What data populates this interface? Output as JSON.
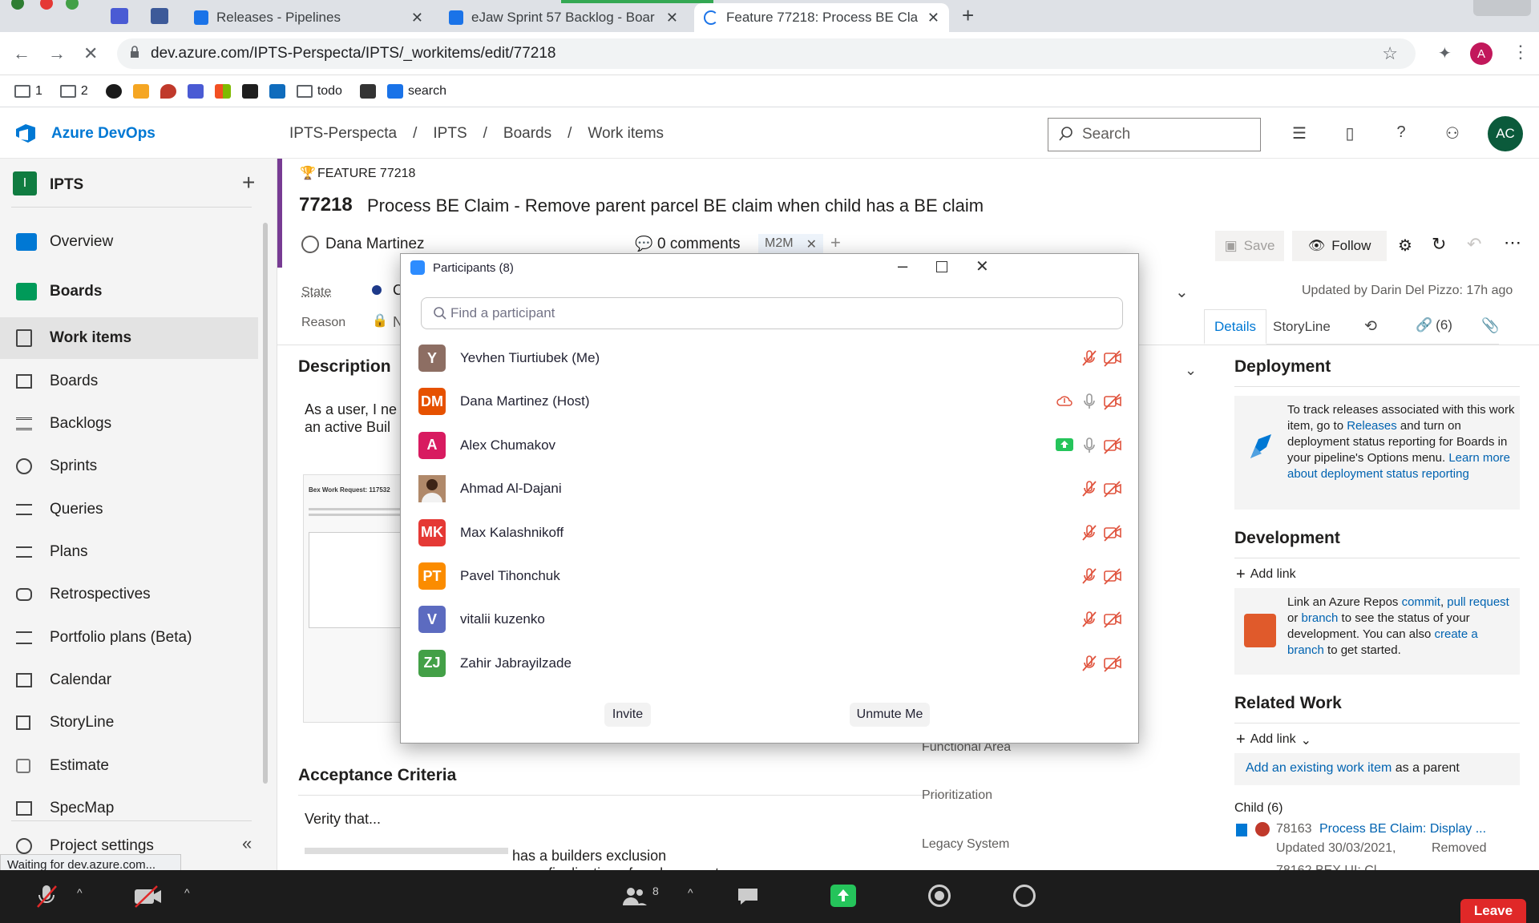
{
  "browser": {
    "tabs": [
      {
        "label": "Releases - Pipelines"
      },
      {
        "label": "eJaw Sprint 57 Backlog - Boar"
      },
      {
        "label": "Feature 77218: Process BE Cla"
      }
    ],
    "url": "dev.azure.com/IPTS-Perspecta/IPTS/_workitems/edit/77218",
    "bookmarks": [
      "1",
      "2",
      "todo",
      "search"
    ],
    "profile_initial": "A",
    "status": "Waiting for dev.azure.com..."
  },
  "ado": {
    "brand": "Azure DevOps",
    "breadcrumb": [
      "IPTS-Perspecta",
      "IPTS",
      "Boards",
      "Work items"
    ],
    "search_placeholder": "Search",
    "user_initials": "AC",
    "project": {
      "initial": "I",
      "name": "IPTS"
    },
    "nav": [
      {
        "label": "Overview",
        "icon": "overview-icon"
      },
      {
        "label": "Boards",
        "icon": "boards-hub-icon"
      },
      {
        "label": "Work items",
        "icon": "work-items-icon"
      },
      {
        "label": "Boards",
        "icon": "boards-icon"
      },
      {
        "label": "Backlogs",
        "icon": "backlogs-icon"
      },
      {
        "label": "Sprints",
        "icon": "sprints-icon"
      },
      {
        "label": "Queries",
        "icon": "queries-icon"
      },
      {
        "label": "Plans",
        "icon": "plans-icon"
      },
      {
        "label": "Retrospectives",
        "icon": "retrospectives-icon"
      },
      {
        "label": "Portfolio plans (Beta)",
        "icon": "portfolio-plans-icon"
      },
      {
        "label": "Calendar",
        "icon": "calendar-icon"
      },
      {
        "label": "StoryLine",
        "icon": "storyline-icon"
      },
      {
        "label": "Estimate",
        "icon": "estimate-icon"
      },
      {
        "label": "SpecMap",
        "icon": "specmap-icon"
      },
      {
        "label": "Project settings",
        "icon": "settings-icon"
      }
    ]
  },
  "workitem": {
    "type_label": "FEATURE 77218",
    "id": "77218",
    "title": "Process BE Claim - Remove parent parcel BE claim when child has a BE claim",
    "assignee": "Dana Martinez",
    "comments": "0 comments",
    "tag": "M2M",
    "save_label": "Save",
    "follow_label": "Follow",
    "updated": "Updated by Darin Del Pizzo: 17h ago",
    "state_label": "State",
    "state_value": "C",
    "reason_label": "Reason",
    "reason_value": "N",
    "tabs": {
      "details": "Details",
      "storyline": "StoryLine",
      "links": "(6)"
    },
    "description_title": "Description",
    "description_text_1": "As a user, I ne",
    "description_text_2": "an active Buil",
    "thumb_title": "Bex Work Request: 117532",
    "acceptance_title": "Acceptance Criteria",
    "acceptance_text_1": "Verity that...",
    "acceptance_text_2": "has a builders exclusion",
    "acceptance_text_3": "upon finalization of work request",
    "fields": [
      "Functional Area",
      "Prioritization",
      "Legacy System"
    ],
    "deployment": {
      "title": "Deployment",
      "text_1": "To track releases associated with this work item, go to ",
      "link_1": "Releases",
      "text_2": " and turn on deployment status reporting for Boards in your pipeline's Options menu. ",
      "link_2": "Learn more about deployment status reporting"
    },
    "development": {
      "title": "Development",
      "add_link": "Add link",
      "text_1": "Link an Azure Repos ",
      "link_commit": "commit",
      "link_pr": "pull request",
      "text_or": " or ",
      "link_branch": "branch",
      "text_2": " to see the status of your development. You can also ",
      "link_create": "create a branch",
      "text_3": " to get started."
    },
    "related": {
      "title": "Related Work",
      "add_link": "Add link",
      "existing_link": "Add an existing work item",
      "existing_suffix": " as a parent",
      "child_label": "Child (6)",
      "child_id": "78163",
      "child_title": "Process BE Claim: Display ...",
      "child_updated": "Updated 30/03/2021,",
      "child_state": "Removed",
      "child2_partial": "78162 BEX UI: Cl"
    }
  },
  "participants": {
    "title": "Participants (8)",
    "search_placeholder": "Find a participant",
    "invite_label": "Invite",
    "unmute_label": "Unmute Me",
    "people": [
      {
        "initials": "Y",
        "name": "Yevhen Tiurtiubek (Me)",
        "color": "#8d6e63",
        "mic": "muted",
        "video": "off"
      },
      {
        "initials": "DM",
        "name": "Dana Martinez (Host)",
        "color": "#e65100",
        "mic": "on",
        "video": "off",
        "extra": "cloud"
      },
      {
        "initials": "A",
        "name": "Alex Chumakov",
        "color": "#d81b60",
        "mic": "on",
        "video": "off",
        "extra": "share"
      },
      {
        "initials": "",
        "name": "Ahmad Al-Dajani",
        "color": "#7a4a2a",
        "mic": "muted",
        "video": "off",
        "photo": true
      },
      {
        "initials": "MK",
        "name": "Max Kalashnikoff",
        "color": "#e53935",
        "mic": "muted",
        "video": "off"
      },
      {
        "initials": "PT",
        "name": "Pavel Tihonchuk",
        "color": "#fb8c00",
        "mic": "muted",
        "video": "off"
      },
      {
        "initials": "V",
        "name": "vitalii kuzenko",
        "color": "#5c6bc0",
        "mic": "muted",
        "video": "off"
      },
      {
        "initials": "ZJ",
        "name": "Zahir Jabrayilzade",
        "color": "#43a047",
        "mic": "muted",
        "video": "off"
      }
    ]
  },
  "zoom": {
    "participants_count": "8",
    "leave_label": "Leave"
  }
}
